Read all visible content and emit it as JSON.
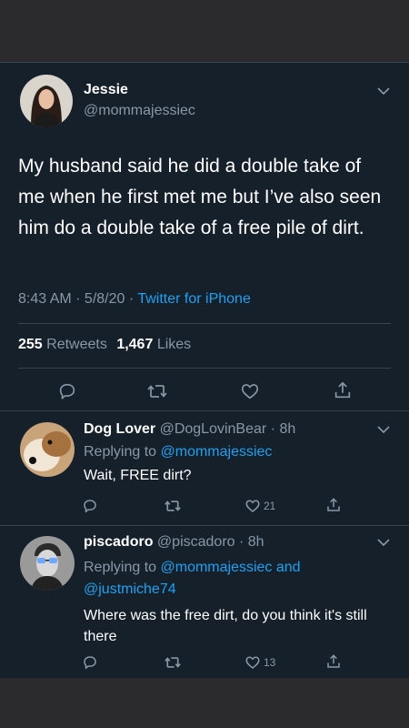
{
  "main_tweet": {
    "display_name": "Jessie",
    "handle": "@mommajessiec",
    "text": "My husband said he did a double take of me when he first met me but I’ve also seen him do a double take of a free pile of dirt.",
    "time": "8:43 AM · 5/8/20 · ",
    "source": "Twitter for iPhone",
    "retweets_count": "255",
    "retweets_label": "Retweets",
    "likes_count": "1,467",
    "likes_label": "Likes"
  },
  "replies": [
    {
      "display_name": "Dog Lover",
      "handle_time": "@DogLovinBear · 8h",
      "replying_prefix": "Replying to ",
      "replying_to": "@mommajessiec",
      "text": "Wait, FREE dirt?",
      "like_count": "21"
    },
    {
      "display_name": "piscadoro",
      "handle_time": "@piscadoro · 8h",
      "replying_prefix": "Replying to ",
      "replying_to": "@mommajessiec and @justmiche74",
      "text": "Where was the free dirt, do you think it's still there",
      "like_count": "13"
    }
  ],
  "colors": {
    "background": "#15202b",
    "accent": "#1da1f2",
    "secondary_text": "#8899a6",
    "divider": "#38444d"
  },
  "icons": [
    "chevron-down-icon",
    "reply-icon",
    "retweet-icon",
    "like-icon",
    "share-icon"
  ]
}
